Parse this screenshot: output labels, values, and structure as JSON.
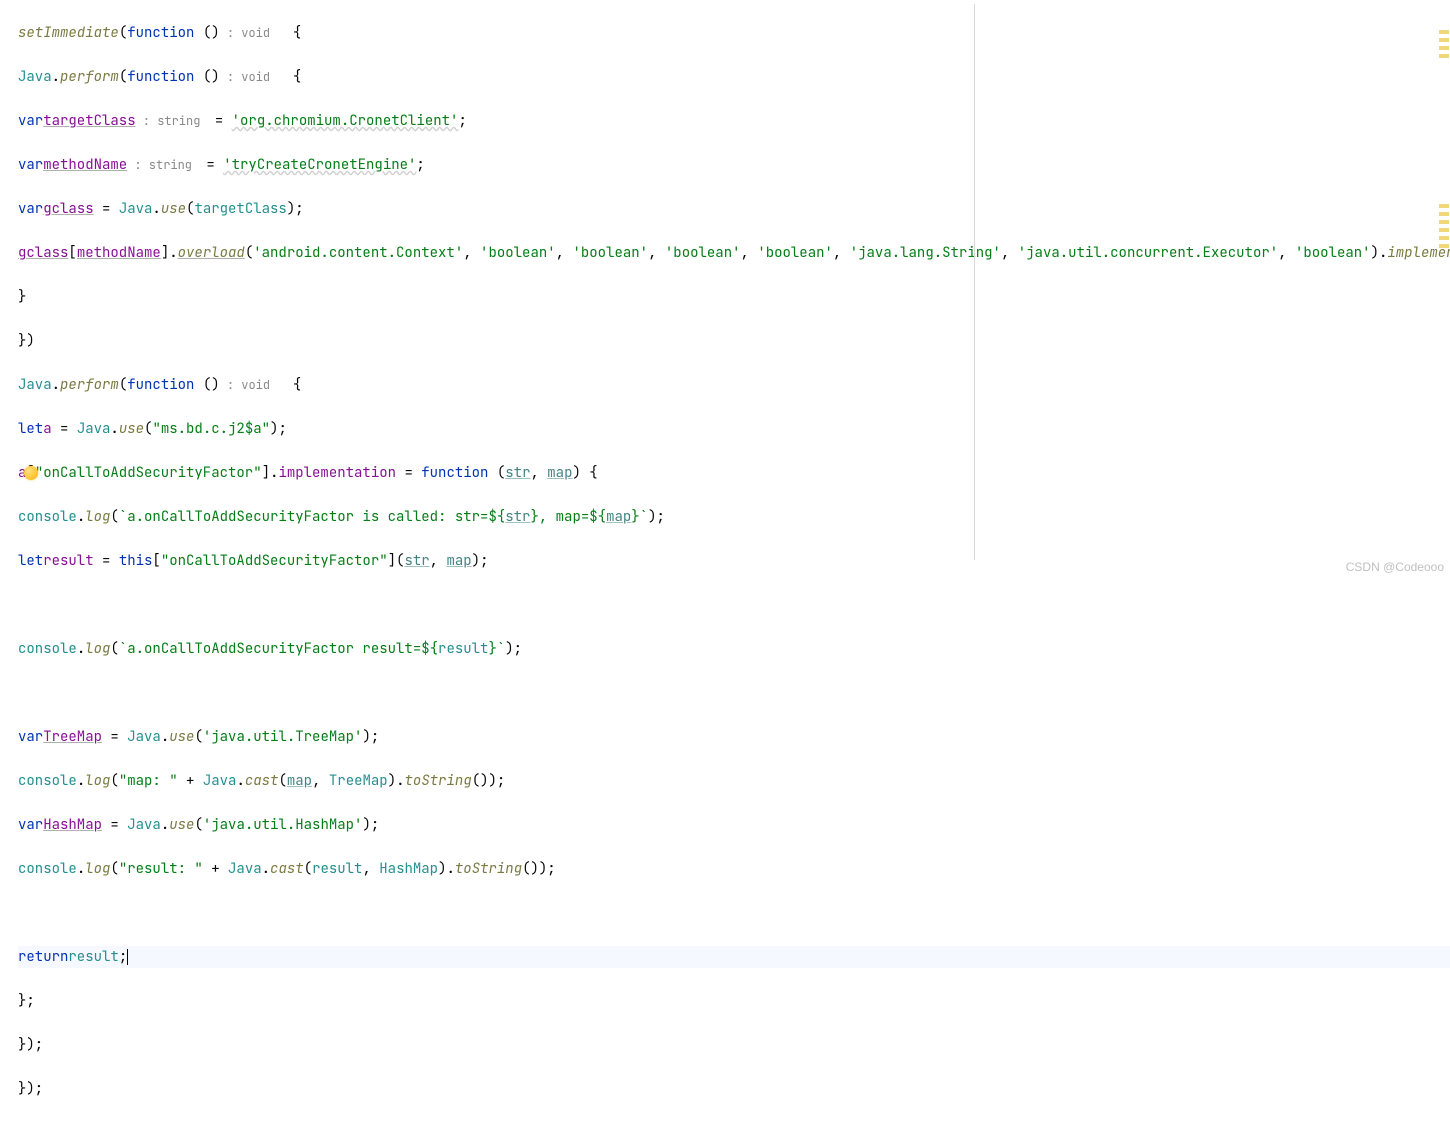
{
  "code": {
    "l1_setImmediate": "setImmediate",
    "l1_function": "function",
    "l1_hint": " : void  ",
    "l2_java": "Java",
    "l2_perform": "perform",
    "l2_function": "function",
    "l2_hint": " : void  ",
    "l3_var": "var",
    "l3_name": "targetClass",
    "l3_hint": " : string  ",
    "l3_str": "'org.chromium.CronetClient'",
    "l4_var": "var",
    "l4_name": "methodName",
    "l4_hint": " : string  ",
    "l4_str": "'tryCreateCronetEngine'",
    "l5_var": "var",
    "l5_name": "gclass",
    "l5_java": "Java",
    "l5_use": "use",
    "l5_arg": "targetClass",
    "l6_gclass": "gclass",
    "l6_methodName": "methodName",
    "l6_overload": "overload",
    "l6_args0": "'android.content.Context'",
    "l6_args1": "'boolean'",
    "l6_args2": "'boolean'",
    "l6_args3": "'boolean'",
    "l6_args4": "'boolean'",
    "l6_args5": "'java.lang.String'",
    "l6_args6": "'java.util.concurrent.Executor'",
    "l6_args7": "'boolean'",
    "l6_implemen": "implemen",
    "l9_java": "Java",
    "l9_perform": "perform",
    "l9_function": "function",
    "l9_hint": " : void  ",
    "l10_let": "let",
    "l10_a": "a",
    "l10_java": "Java",
    "l10_use": "use",
    "l10_str": "\"ms.bd.c.j2$a\"",
    "l11_a": "a",
    "l11_key": "\"onCallToAddSecurityFactor\"",
    "l11_impl": "implementation",
    "l11_function": "function",
    "l11_p1": "str",
    "l11_p2": "map",
    "l12_console": "console",
    "l12_log": "log",
    "l12_t0": "`a.onCallToAddSecurityFactor is called: str=",
    "l12_t1": "${",
    "l12_str": "str",
    "l12_t2": "}",
    "l12_t3": ", map=",
    "l12_t4": "${",
    "l12_map": "map",
    "l12_t5": "}`",
    "l13_let": "let",
    "l13_result": "result",
    "l13_this": "this",
    "l13_key": "\"onCallToAddSecurityFactor\"",
    "l13_p1": "str",
    "l13_p2": "map",
    "l15_console": "console",
    "l15_log": "log",
    "l15_t0": "`a.onCallToAddSecurityFactor result=",
    "l15_t1": "${",
    "l15_result": "result",
    "l15_t2": "}`",
    "l17_var": "var",
    "l17_name": "TreeMap",
    "l17_java": "Java",
    "l17_use": "use",
    "l17_str": "'java.util.TreeMap'",
    "l18_console": "console",
    "l18_log": "log",
    "l18_str": "\"map: \"",
    "l18_java": "Java",
    "l18_cast": "cast",
    "l18_p1": "map",
    "l18_p2": "TreeMap",
    "l18_toString": "toString",
    "l19_var": "var",
    "l19_name": "HashMap",
    "l19_java": "Java",
    "l19_use": "use",
    "l19_str": "'java.util.HashMap'",
    "l20_console": "console",
    "l20_log": "log",
    "l20_str": "\"result: \"",
    "l20_java": "Java",
    "l20_cast": "cast",
    "l20_p1": "result",
    "l20_p2": "HashMap",
    "l20_toString": "toString",
    "l22_return": "return",
    "l22_result": "result"
  },
  "watermark": "CSDN @Codeooo"
}
